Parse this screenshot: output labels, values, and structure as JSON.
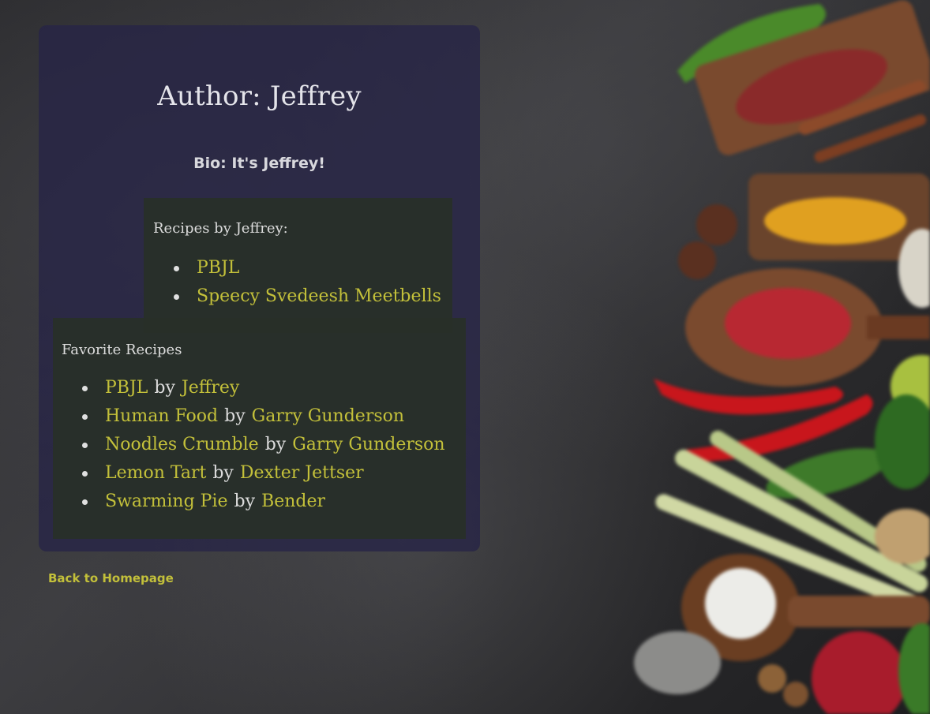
{
  "page": {
    "title": "Author: Jeffrey",
    "bio": "Bio: It's Jeffrey!"
  },
  "recipes_by_author": {
    "heading": "Recipes by Jeffrey:",
    "items": [
      "PBJL",
      "Speecy Svedeesh Meetbells"
    ]
  },
  "favorite_recipes": {
    "heading": "Favorite Recipes",
    "by_label": "by",
    "items": [
      {
        "recipe": "PBJL",
        "author": "Jeffrey"
      },
      {
        "recipe": "Human Food",
        "author": "Garry Gunderson"
      },
      {
        "recipe": "Noodles Crumble",
        "author": "Garry Gunderson"
      },
      {
        "recipe": "Lemon Tart",
        "author": "Dexter Jettser"
      },
      {
        "recipe": "Swarming Pie",
        "author": "Bender"
      }
    ]
  },
  "nav": {
    "back_label": "Back to Homepage"
  },
  "colors": {
    "link": "#c3c03a",
    "card_bg": "#262446",
    "box_bg": "#283028",
    "text": "#dcdcdc"
  }
}
